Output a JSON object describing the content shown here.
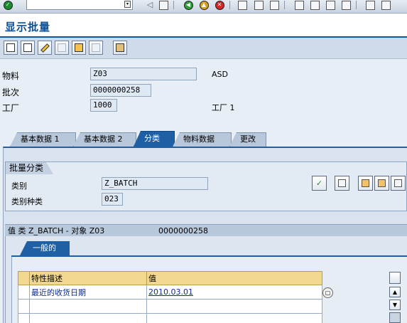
{
  "title": "显示批量",
  "header": {
    "material_label": "物料",
    "material_value": "Z03",
    "material_desc": "ASD",
    "batch_label": "批次",
    "batch_value": "0000000258",
    "plant_label": "工厂",
    "plant_value": "1000",
    "plant_desc": "工厂 1"
  },
  "tabs": [
    {
      "label": "基本数据 1"
    },
    {
      "label": "基本数据 2"
    },
    {
      "label": "分类"
    },
    {
      "label": "物料数据"
    },
    {
      "label": "更改"
    }
  ],
  "active_tab": "分类",
  "classification": {
    "group_title": "批量分类",
    "class_label": "类别",
    "class_value": "Z_BATCH",
    "class_type_label": "类别种类",
    "class_type_value": "023"
  },
  "values": {
    "bar_text": "值 类 Z_BATCH - 对象 Z03",
    "bar_object": "0000000258",
    "subtab_label": "一般的",
    "columns": [
      "特性描述",
      "值"
    ],
    "rows": [
      {
        "description": "最近的收货日期",
        "value": "2010.03.01"
      }
    ]
  },
  "colors": {
    "active_tab": "#1f5fa6",
    "title_text": "#0b4f96",
    "table_header": "#f2d791"
  }
}
